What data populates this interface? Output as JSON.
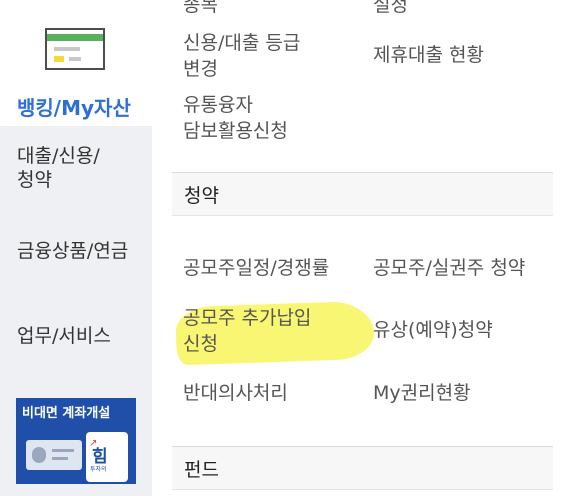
{
  "colors": {
    "sidebar_bg": "#eff0f3",
    "active_label": "#2e6fd6",
    "highlight": "#f7f55b",
    "banner_bg": "#1f4fa8"
  },
  "sidebar": {
    "active": {
      "icon": "bank-card-icon",
      "label": "뱅킹/My자산"
    },
    "items": [
      {
        "label": "대출/신용/\n청약"
      },
      {
        "label": "금융상품/연금"
      },
      {
        "label": "업무/서비스"
      }
    ],
    "banner": {
      "text_plain": "비대면 ",
      "text_bold": "계좌개설",
      "logo_text": "힘",
      "logo_small": "투자의"
    }
  },
  "main": {
    "top_partial": {
      "left": "종목",
      "right": "설정"
    },
    "loan_rows": [
      {
        "left": "신용/대출 등급\n변경",
        "right": "제휴대출 현황"
      },
      {
        "left": "유통융자\n담보활용신청",
        "right": ""
      }
    ],
    "subscription": {
      "header": "청약",
      "items": [
        {
          "left": "공모주일정/경쟁률",
          "right": "공모주/실권주 청약"
        },
        {
          "left": "공모주 추가납입\n신청",
          "right": "유상(예약)청약"
        },
        {
          "left": "반대의사처리",
          "right": "My권리현황"
        }
      ]
    },
    "fund": {
      "header": "펀드"
    }
  }
}
